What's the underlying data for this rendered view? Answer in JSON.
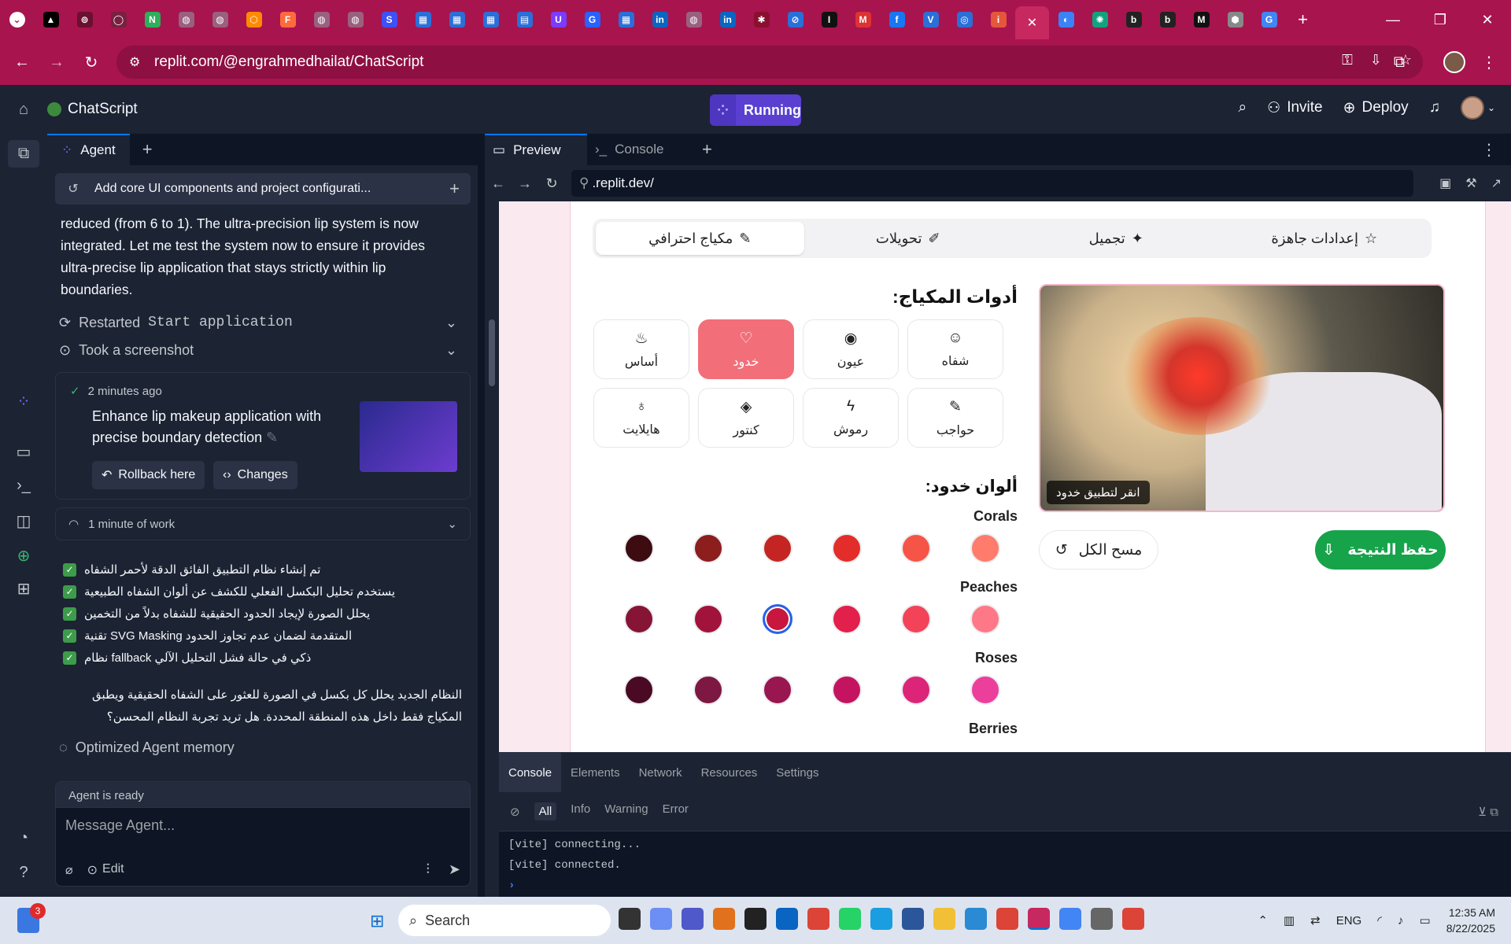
{
  "browser": {
    "url": "replit.com/@engrahmedhailat/ChatScript",
    "tab_favicons": [
      {
        "name": "tab-favicon-1",
        "color": "#000000",
        "glyph": "▲"
      },
      {
        "name": "tab-favicon-2",
        "color": "#6a1030",
        "glyph": "⊚"
      },
      {
        "name": "tab-favicon-3",
        "color": "#7a2040",
        "glyph": "◯"
      },
      {
        "name": "tab-favicon-4",
        "color": "#2fae5c",
        "glyph": "N"
      },
      {
        "name": "tab-favicon-5",
        "color": "#9a6080",
        "glyph": "◍"
      },
      {
        "name": "tab-favicon-6",
        "color": "#9a6080",
        "glyph": "◍"
      },
      {
        "name": "tab-favicon-7",
        "color": "#ff8a00",
        "glyph": "⬡"
      },
      {
        "name": "tab-favicon-8",
        "color": "#ff6a3d",
        "glyph": "F"
      },
      {
        "name": "tab-favicon-9",
        "color": "#9a6080",
        "glyph": "◍"
      },
      {
        "name": "tab-favicon-10",
        "color": "#9a6080",
        "glyph": "◍"
      },
      {
        "name": "tab-favicon-11",
        "color": "#3f51f5",
        "glyph": "S"
      },
      {
        "name": "tab-favicon-12",
        "color": "#2b6fd8",
        "glyph": "▦"
      },
      {
        "name": "tab-favicon-13",
        "color": "#2b6fd8",
        "glyph": "▦"
      },
      {
        "name": "tab-favicon-14",
        "color": "#2b6fd8",
        "glyph": "▦"
      },
      {
        "name": "tab-favicon-15",
        "color": "#2b6fd8",
        "glyph": "▤"
      },
      {
        "name": "tab-favicon-16",
        "color": "#7a3cff",
        "glyph": "U"
      },
      {
        "name": "tab-favicon-17",
        "color": "#2962ff",
        "glyph": "G"
      },
      {
        "name": "tab-favicon-18",
        "color": "#2b6fd8",
        "glyph": "▦"
      },
      {
        "name": "tab-favicon-19",
        "color": "#0a66c2",
        "glyph": "in"
      },
      {
        "name": "tab-favicon-20",
        "color": "#9a6080",
        "glyph": "◍"
      },
      {
        "name": "tab-favicon-21",
        "color": "#0a66c2",
        "glyph": "in"
      },
      {
        "name": "tab-favicon-22",
        "color": "#8a1030",
        "glyph": "✱"
      },
      {
        "name": "tab-favicon-23",
        "color": "#2b6fd8",
        "glyph": "⊘"
      },
      {
        "name": "tab-favicon-24",
        "color": "#111111",
        "glyph": "I"
      },
      {
        "name": "tab-favicon-25",
        "color": "#d33",
        "glyph": "M"
      },
      {
        "name": "tab-favicon-26",
        "color": "#1877f2",
        "glyph": "f"
      },
      {
        "name": "tab-favicon-27",
        "color": "#2b6fd8",
        "glyph": "V"
      },
      {
        "name": "tab-favicon-28",
        "color": "#2b6fd8",
        "glyph": "◎"
      },
      {
        "name": "tab-favicon-29",
        "color": "#e4573d",
        "glyph": "i"
      },
      {
        "name": "tab-favicon-30",
        "color": "#c7285f",
        "glyph": "✕",
        "active": true
      },
      {
        "name": "tab-favicon-31",
        "color": "#3b82f6",
        "glyph": "◐"
      },
      {
        "name": "tab-favicon-32",
        "color": "#10a37f",
        "glyph": "✺"
      },
      {
        "name": "tab-favicon-33",
        "color": "#222",
        "glyph": "b"
      },
      {
        "name": "tab-favicon-34",
        "color": "#222",
        "glyph": "b"
      },
      {
        "name": "tab-favicon-35",
        "color": "#111",
        "glyph": "M"
      },
      {
        "name": "tab-favicon-36",
        "color": "#888",
        "glyph": "⬢"
      },
      {
        "name": "tab-favicon-37",
        "color": "#4285f4",
        "glyph": "G"
      }
    ]
  },
  "workspace": {
    "project_name": "ChatScript",
    "run_label": "Running",
    "invite_label": "Invite",
    "deploy_label": "Deploy"
  },
  "agent": {
    "tab_label": "Agent",
    "thread_title": "Add core UI components and project configurati...",
    "message": "reduced (from 6 to 1). The ultra-precision lip system is now integrated. Let me test the system now to ensure it provides ultra-precise lip application that stays strictly within lip boundaries.",
    "restarted_label": "Restarted",
    "restarted_cmd": "Start application",
    "screenshot_label": "Took a screenshot",
    "checkpoint_time": "2 minutes ago",
    "checkpoint_title": "Enhance lip makeup application with precise boundary detection",
    "rollback_label": "Rollback here",
    "changes_label": "Changes",
    "work_label": "1 minute of work",
    "checks": [
      "تم إنشاء نظام التطبيق الفائق الدقة لأحمر الشفاه",
      "يستخدم تحليل البكسل الفعلي للكشف عن ألوان الشفاه الطبيعية",
      "يحلل الصورة لإيجاد الحدود الحقيقية للشفاه بدلاً من التخمين",
      "تقنية SVG Masking المتقدمة لضمان عدم تجاوز الحدود",
      "نظام fallback ذكي في حالة فشل التحليل الآلي"
    ],
    "summary_ar": "النظام الجديد يحلل كل بكسل في الصورة للعثور على الشفاه الحقيقية ويطبق المكياج فقط داخل هذه المنطقة المحددة. هل تريد تجربة النظام المحسن؟",
    "memory_label": "Optimized Agent memory",
    "status": "Agent is ready",
    "composer_placeholder": "Message Agent...",
    "edit_label": "Edit"
  },
  "preview": {
    "tab_preview": "Preview",
    "tab_console": "Console",
    "url": ".replit.dev/",
    "modes": [
      "مكياج احترافي",
      "تحويلات",
      "تجميل",
      "إعدادات جاهزة"
    ],
    "active_mode": 0,
    "tools_heading": "أدوات المكياج:",
    "tools": [
      {
        "label": "شفاه",
        "icon": "☺"
      },
      {
        "label": "عيون",
        "icon": "◉"
      },
      {
        "label": "خدود",
        "icon": "♡",
        "active": true
      },
      {
        "label": "أساس",
        "icon": "♨"
      },
      {
        "label": "حواجب",
        "icon": "✎"
      },
      {
        "label": "رموش",
        "icon": "ϟ"
      },
      {
        "label": "كنتور",
        "icon": "◈"
      },
      {
        "label": "هايلايت",
        "icon": "♁"
      }
    ],
    "photo_hint": "انقر لتطبيق خدود",
    "save_label": "حفظ النتيجة",
    "clear_label": "مسح الكل",
    "colors_heading": "ألوان خدود:",
    "groups": [
      {
        "name": "Corals",
        "colors": [
          "#ff7b6b",
          "#f65446",
          "#e32d2a",
          "#c42523",
          "#8c1e1e",
          "#3c0c10"
        ]
      },
      {
        "name": "Peaches",
        "colors": [
          "#fe7888",
          "#f34359",
          "#e31f4b",
          "#c8163f",
          "#a2133b",
          "#861535"
        ]
      },
      {
        "name": "Roses",
        "colors": [
          "#ec3f9c",
          "#dc2478",
          "#c41460",
          "#991650",
          "#7c1842",
          "#4a0a24"
        ]
      },
      {
        "name": "Berries",
        "colors": []
      }
    ],
    "selected_color": "#c8163f"
  },
  "devtools": {
    "tabs": [
      "Console",
      "Elements",
      "Network",
      "Resources",
      "Settings"
    ],
    "filters": [
      "All",
      "Info",
      "Warning",
      "Error"
    ],
    "logs": [
      "[vite] connecting...",
      "[vite] connected."
    ]
  },
  "taskbar": {
    "search_placeholder": "Search",
    "badge_count": "3",
    "lang": "ENG",
    "time": "12:35 AM",
    "date": "8/22/2025"
  }
}
